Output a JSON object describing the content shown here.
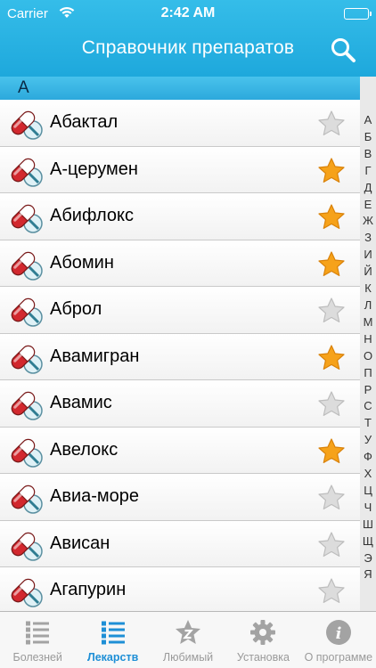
{
  "status": {
    "carrier": "Carrier",
    "time": "2:42 AM"
  },
  "header": {
    "title": "Справочник препаратов"
  },
  "section": {
    "letter": "А"
  },
  "drugs": [
    {
      "name": "Абактал",
      "favorite": false
    },
    {
      "name": "А-церумен",
      "favorite": true
    },
    {
      "name": "Абифлокс",
      "favorite": true
    },
    {
      "name": "Абомин",
      "favorite": true
    },
    {
      "name": "Аброл",
      "favorite": false
    },
    {
      "name": "Авамигран",
      "favorite": true
    },
    {
      "name": "Авамис",
      "favorite": false
    },
    {
      "name": "Авелокс",
      "favorite": true
    },
    {
      "name": "Авиа-море",
      "favorite": false
    },
    {
      "name": "Ависан",
      "favorite": false
    },
    {
      "name": "Агапурин",
      "favorite": false
    }
  ],
  "index_letters": [
    "А",
    "Б",
    "В",
    "Г",
    "Д",
    "Е",
    "Ж",
    "З",
    "И",
    "Й",
    "К",
    "Л",
    "М",
    "Н",
    "О",
    "П",
    "Р",
    "С",
    "Т",
    "У",
    "Ф",
    "Х",
    "Ц",
    "Ч",
    "Ш",
    "Щ",
    "Э",
    "Я"
  ],
  "tabs": [
    {
      "label": "Болезней",
      "icon": "list-icon",
      "active": false
    },
    {
      "label": "Лекарств",
      "icon": "list-icon",
      "active": true
    },
    {
      "label": "Любимый",
      "icon": "star-badge-icon",
      "active": false
    },
    {
      "label": "Установка",
      "icon": "gear-icon",
      "active": false
    },
    {
      "label": "О программе",
      "icon": "info-icon",
      "active": false
    }
  ],
  "colors": {
    "header": "#1ea8dc",
    "star_active": "#f6a21a",
    "star_inactive": "#dcdcdc",
    "pill_red": "#d2282e",
    "tab_active": "#1e8fd6"
  }
}
